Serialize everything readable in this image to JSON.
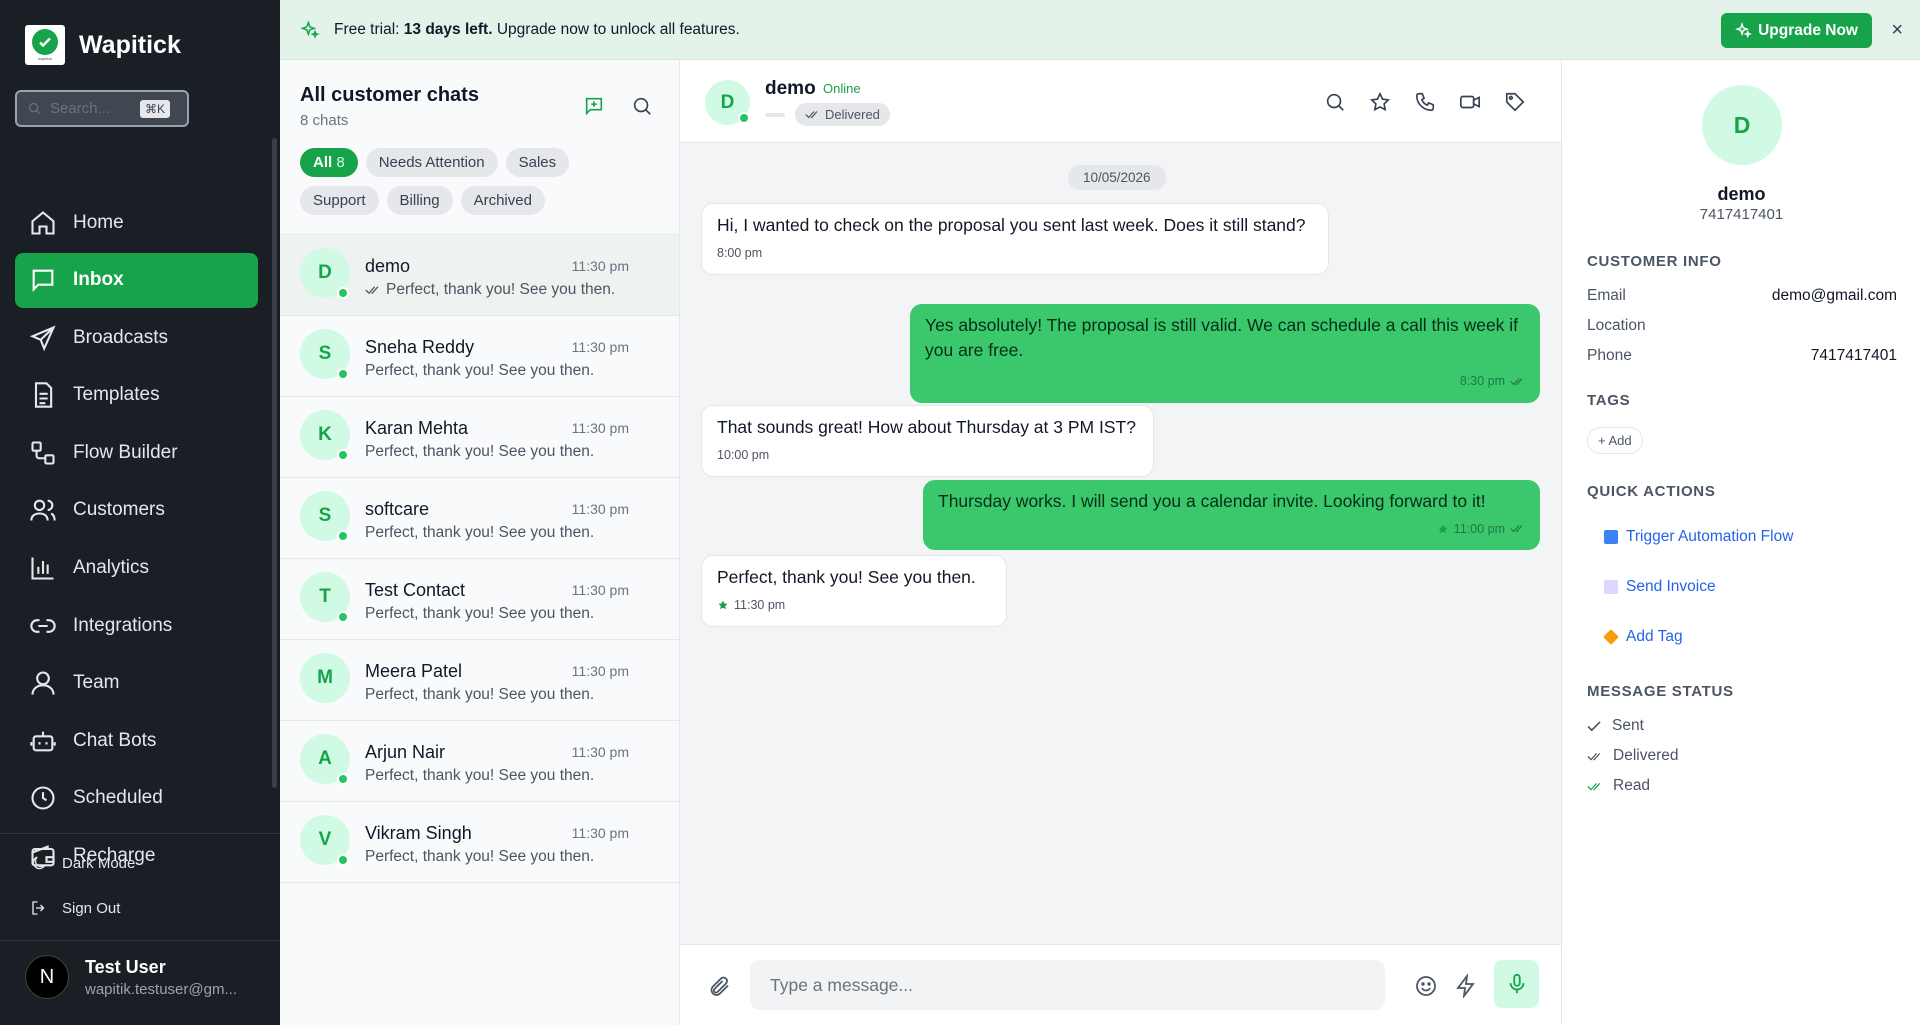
{
  "sidebar": {
    "brand": "Wapitick",
    "logo_text": "wapitick",
    "search_placeholder": "Search...",
    "shortcut": "⌘K",
    "nav": [
      {
        "label": "Home",
        "icon": "home-icon"
      },
      {
        "label": "Inbox",
        "icon": "inbox-icon"
      },
      {
        "label": "Broadcasts",
        "icon": "send-icon"
      },
      {
        "label": "Templates",
        "icon": "file-icon"
      },
      {
        "label": "Flow Builder",
        "icon": "flow-icon"
      },
      {
        "label": "Customers",
        "icon": "users-icon"
      },
      {
        "label": "Analytics",
        "icon": "chart-icon"
      },
      {
        "label": "Integrations",
        "icon": "link-icon"
      },
      {
        "label": "Team",
        "icon": "user-icon"
      },
      {
        "label": "Chat Bots",
        "icon": "bot-icon"
      },
      {
        "label": "Scheduled",
        "icon": "clock-icon"
      },
      {
        "label": "Recharge",
        "icon": "wallet-icon"
      }
    ],
    "active_item": "Inbox",
    "dark_mode": "Dark Mode",
    "sign_out": "Sign Out",
    "user": {
      "initial": "N",
      "name": "Test User",
      "email": "wapitik.testuser@gm..."
    }
  },
  "banner": {
    "prefix": "Free trial:",
    "days": "13 days left.",
    "suffix": "Upgrade now to unlock all features.",
    "button": "Upgrade Now",
    "close": "×"
  },
  "chat_list": {
    "title": "All customer chats",
    "count": "8 chats",
    "filters": [
      {
        "label": "All",
        "count": "8"
      },
      {
        "label": "Needs Attention"
      },
      {
        "label": "Sales"
      },
      {
        "label": "Support"
      },
      {
        "label": "Billing"
      },
      {
        "label": "Archived"
      }
    ],
    "conversations": [
      {
        "initial": "D",
        "name": "demo",
        "time": "11:30 pm",
        "preview": "Perfect, thank you! See you then.",
        "ticks": true,
        "active": true
      },
      {
        "initial": "S",
        "name": "Sneha Reddy",
        "time": "11:30 pm",
        "preview": "Perfect, thank you! See you then."
      },
      {
        "initial": "K",
        "name": "Karan Mehta",
        "time": "11:30 pm",
        "preview": "Perfect, thank you! See you then."
      },
      {
        "initial": "S",
        "name": "softcare",
        "time": "11:30 pm",
        "preview": "Perfect, thank you! See you then."
      },
      {
        "initial": "T",
        "name": "Test Contact",
        "time": "11:30 pm",
        "preview": "Perfect, thank you! See you then."
      },
      {
        "initial": "M",
        "name": "Meera Patel",
        "time": "11:30 pm",
        "preview": "Perfect, thank you! See you then.",
        "offline": true
      },
      {
        "initial": "A",
        "name": "Arjun Nair",
        "time": "11:30 pm",
        "preview": "Perfect, thank you! See you then."
      },
      {
        "initial": "V",
        "name": "Vikram Singh",
        "time": "11:30 pm",
        "preview": "Perfect, thank you! See you then."
      }
    ]
  },
  "chat": {
    "contact_initial": "D",
    "contact_name": "demo",
    "status": "Online",
    "delivery": "Delivered",
    "date": "10/05/2026",
    "messages": [
      {
        "dir": "in",
        "text": "Hi, I wanted to check on the proposal you sent last week. Does it still stand?",
        "time": "8:00 pm"
      },
      {
        "dir": "out",
        "text": "Yes absolutely! The proposal is still valid. We can schedule a call this week if you are free.",
        "time": "8:30 pm"
      },
      {
        "dir": "in",
        "text": "That sounds great! How about Thursday at 3 PM IST?",
        "time": "10:00 pm"
      },
      {
        "dir": "out",
        "text": "Thursday works. I will send you a calendar invite. Looking forward to it!",
        "time": "11:00 pm",
        "starred": true
      },
      {
        "dir": "in",
        "text": "Perfect, thank you! See you then.",
        "time": "11:30 pm",
        "starred": true
      }
    ],
    "composer_placeholder": "Type a message..."
  },
  "details": {
    "initial": "D",
    "name": "demo",
    "phone": "7417417401",
    "customer_info_title": "CUSTOMER INFO",
    "info": [
      {
        "key": "Email",
        "value": "demo@gmail.com"
      },
      {
        "key": "Location",
        "value": ""
      },
      {
        "key": "Phone",
        "value": "7417417401"
      }
    ],
    "tags_title": "TAGS",
    "add_tag": "+ Add",
    "quick_actions_title": "QUICK ACTIONS",
    "quick_actions": [
      {
        "label": "Trigger Automation Flow",
        "color": "#3b82f6"
      },
      {
        "label": "Send Invoice",
        "color": "#c4b5fd"
      },
      {
        "label": "Add Tag",
        "color": "#f59e0b"
      }
    ],
    "message_status_title": "MESSAGE STATUS",
    "statuses": [
      {
        "label": "Sent"
      },
      {
        "label": "Delivered"
      },
      {
        "label": "Read"
      }
    ]
  },
  "colors": {
    "brand": "#16a34a",
    "sidebar_bg": "#1a1f26",
    "outgoing_bubble": "#3bc86c",
    "read_tick": "#16a34a"
  }
}
